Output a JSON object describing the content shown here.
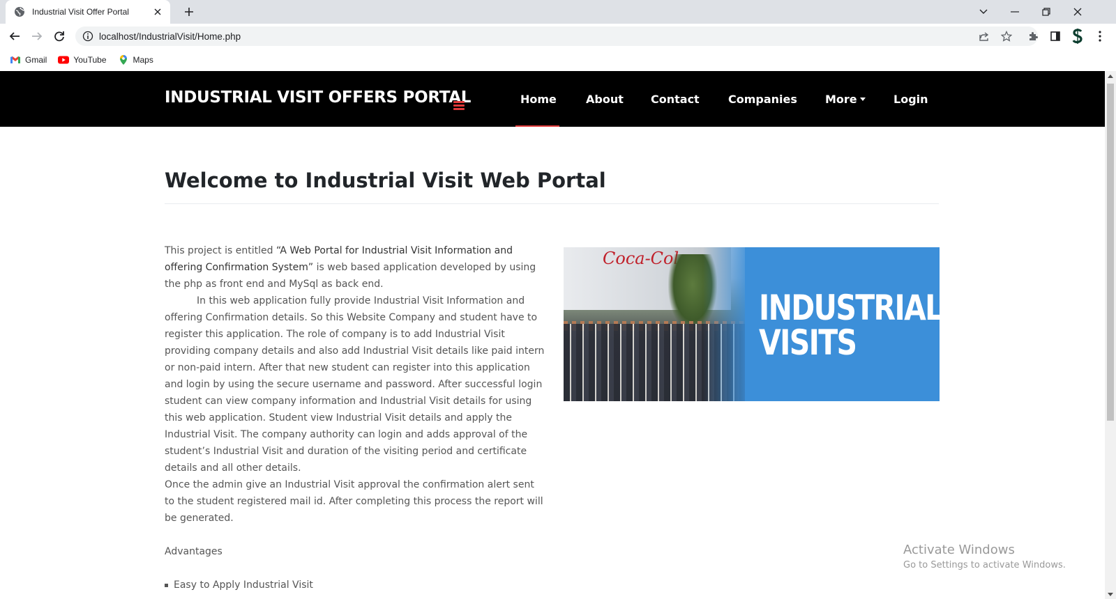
{
  "browser": {
    "tab_title": "Industrial Visit Offer Portal",
    "url": "localhost/IndustrialVisit/Home.php",
    "bookmarks": [
      {
        "label": "Gmail",
        "icon": "gmail-icon"
      },
      {
        "label": "YouTube",
        "icon": "youtube-icon"
      },
      {
        "label": "Maps",
        "icon": "maps-icon"
      }
    ]
  },
  "site": {
    "brand": "INDUSTRIAL VISIT OFFERS PORTAL",
    "nav": [
      {
        "label": "Home",
        "active": true
      },
      {
        "label": "About"
      },
      {
        "label": "Contact"
      },
      {
        "label": "Companies"
      },
      {
        "label": "More"
      },
      {
        "label": "Login"
      }
    ]
  },
  "main": {
    "title": "Welcome to Industrial Visit Web Portal",
    "intro_prefix": "This project is entitled ",
    "intro_bold": "“A Web Portal for Industrial Visit Information and offering Confirmation System”",
    "intro_suffix": " is web based application developed by using the php as front end and  MySql as back end.",
    "para2": "In this web application fully provide Industrial Visit Information and offering Confirmation details. So this Website Company and student have to register this application. The role of company is to add Industrial Visit providing company details and also add Industrial Visit details like paid intern or non-paid intern. After that new student can register into this application and login by using the secure username and password. After successful login student can view company information and Industrial Visit details for using this web application.  Student view Industrial Visit details and apply the Industrial Visit. The company authority can login and adds approval of the student’s Industrial Visit and duration of the visiting period and certificate details and all other details.",
    "para3": "Once the admin give an Industrial Visit approval the confirmation alert sent to the student registered mail id. After completing this process the report will be generated.",
    "advantages_heading": "Advantages",
    "advantages": [
      "Easy to Apply Industrial Visit"
    ],
    "hero_line1": "INDUSTRIAL",
    "hero_line2": "VISITS",
    "hero_logo": "Coca-Cola"
  },
  "watermark": {
    "line1": "Activate Windows",
    "line2": "Go to Settings to activate Windows."
  },
  "colors": {
    "header_bg": "#000000",
    "accent": "#e03a3a",
    "hero_bg": "#3c8fd9"
  }
}
